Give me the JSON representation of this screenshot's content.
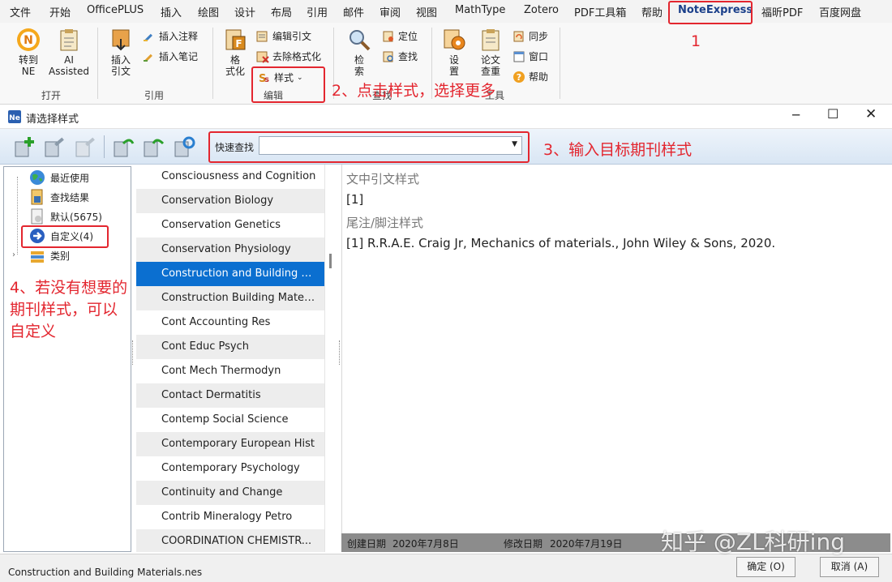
{
  "menubar": {
    "items": [
      "文件",
      "开始",
      "OfficePLUS",
      "插入",
      "绘图",
      "设计",
      "布局",
      "引用",
      "邮件",
      "审阅",
      "视图",
      "MathType",
      "Zotero",
      "PDF工具箱",
      "帮助",
      "NoteExpress",
      "福昕PDF",
      "百度网盘"
    ],
    "active": "NoteExpress"
  },
  "ribbon": {
    "goto_ne": "转到\nNE",
    "ai_assisted": "AI\nAssisted",
    "group_open": "打开",
    "insert_cite": "插入\n引文",
    "insert_note": "插入注释",
    "insert_memo": "插入笔记",
    "group_cite": "引用",
    "format": "格\n式化",
    "edit_cite": "编辑引文",
    "remove_format": "去除格式化",
    "style": "样式",
    "group_edit": "编辑",
    "search": "检\n索",
    "locate": "定位",
    "find": "查找",
    "group_find": "查找",
    "settings": "设\n置",
    "paper_check": "论文\n查重",
    "sync": "同步",
    "window": "窗口",
    "help": "帮助",
    "group_tools": "工具"
  },
  "dialog": {
    "title": "请选择样式",
    "quick_find_label": "快速查找",
    "quick_find_value": "",
    "tree": [
      "最近使用",
      "查找结果",
      "默认(5675)",
      "自定义(4)",
      "类别"
    ],
    "styles": [
      "Consciousness and Cognition",
      "Conservation Biology",
      "Conservation Genetics",
      "Conservation Physiology",
      "Construction and Building M...",
      "Construction Building Materi...",
      "Cont Accounting Res",
      "Cont Educ Psych",
      "Cont Mech Thermodyn",
      "Contact Dermatitis",
      "Contemp Social Science",
      "Contemporary European Hist",
      "Contemporary Psychology",
      "Continuity and Change",
      "Contrib Mineralogy Petro",
      "COORDINATION CHEMISTR..."
    ],
    "selected_index": 4,
    "preview": {
      "in_text_heading": "文中引文样式",
      "in_text_example": "[1]",
      "endnote_heading": "尾注/脚注样式",
      "endnote_example": "[1] R.R.A.E. Craig Jr, Mechanics of materials., John Wiley & Sons, 2020."
    },
    "created_label": "创建日期",
    "created_value": "2020年7月8日",
    "modified_label": "修改日期",
    "modified_value": "2020年7月19日",
    "status_file": "Construction and Building Materials.nes",
    "ok_label": "确定 (O)",
    "cancel_label": "取消 (A)"
  },
  "annotations": {
    "step1": "1",
    "step2": "2、点击样式，选择更多",
    "step3": "3、输入目标期刊样式",
    "step4_line1": "4、若没有想要的",
    "step4_line2": "期刊样式，可以",
    "step4_line3": "自定义"
  },
  "watermark": "知乎 @ZL科研ing",
  "colors": {
    "annotation_red": "#e3262f",
    "selection_blue": "#0b6fd0",
    "ne_blue": "#1a3f8a"
  }
}
